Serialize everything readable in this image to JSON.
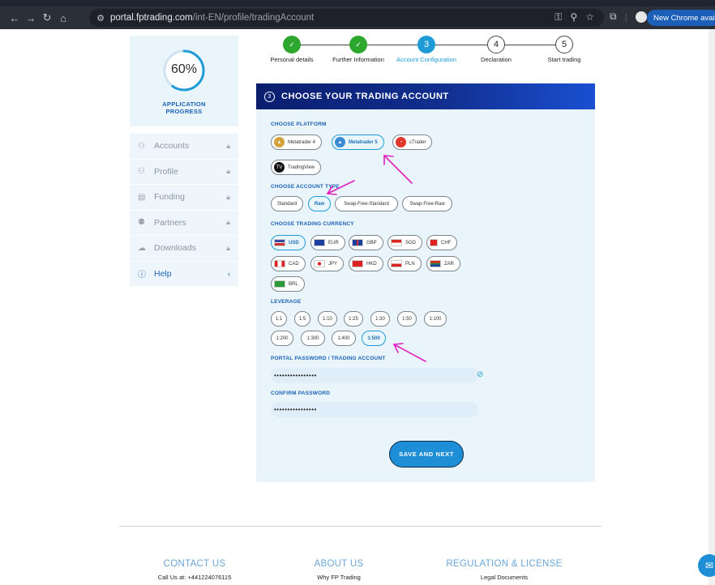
{
  "browser": {
    "url_host": "portal.fptrading.com",
    "url_path": "/int-EN/profile/tradingAccount",
    "update_label": "New Chrome available"
  },
  "sidebar": {
    "progress_value": "60%",
    "progress_fraction": 0.6,
    "progress_label_line1": "APPLICATION",
    "progress_label_line2": "PROGRESS",
    "items": [
      {
        "label": "Accounts",
        "icon": "user-icon",
        "locked": true
      },
      {
        "label": "Profile",
        "icon": "profile-icon",
        "locked": true
      },
      {
        "label": "Funding",
        "icon": "document-icon",
        "locked": true
      },
      {
        "label": "Partners",
        "icon": "partners-icon",
        "locked": true
      },
      {
        "label": "Downloads",
        "icon": "cloud-download-icon",
        "locked": true
      },
      {
        "label": "Help",
        "icon": "help-icon",
        "locked": false
      }
    ]
  },
  "stepper": {
    "steps": [
      {
        "label": "Personal details",
        "state": "done",
        "mark": "✓"
      },
      {
        "label": "Further Information",
        "state": "done",
        "mark": "✓"
      },
      {
        "label": "Account Configuration",
        "state": "active",
        "mark": "3"
      },
      {
        "label": "Declaration",
        "state": "todo",
        "mark": "4"
      },
      {
        "label": "Start trading",
        "state": "todo",
        "mark": "5"
      }
    ]
  },
  "form": {
    "step_number": "3",
    "title": "CHOOSE YOUR TRADING ACCOUNT",
    "platform_label": "CHOOSE PLATFORM",
    "platforms": [
      {
        "label": "Metatrader 4",
        "selected": false
      },
      {
        "label": "Metatrader 5",
        "selected": true
      },
      {
        "label": "cTrader",
        "selected": false
      },
      {
        "label": "TradingView",
        "selected": false
      }
    ],
    "account_type_label": "CHOOSE ACCOUNT TYPE",
    "account_types": [
      {
        "label": "Standard",
        "selected": false
      },
      {
        "label": "Raw",
        "selected": true
      },
      {
        "label": "Swap-Free-Standard",
        "selected": false
      },
      {
        "label": "Swap-Free-Raw",
        "selected": false
      }
    ],
    "currency_label": "CHOOSE TRADING CURRENCY",
    "currencies": [
      {
        "label": "USD",
        "selected": true
      },
      {
        "label": "EUR",
        "selected": false
      },
      {
        "label": "GBP",
        "selected": false
      },
      {
        "label": "SGD",
        "selected": false
      },
      {
        "label": "CHF",
        "selected": false
      },
      {
        "label": "CAD",
        "selected": false
      },
      {
        "label": "JPY",
        "selected": false
      },
      {
        "label": "HKD",
        "selected": false
      },
      {
        "label": "PLN",
        "selected": false
      },
      {
        "label": "ZAR",
        "selected": false
      },
      {
        "label": "BRL",
        "selected": false
      }
    ],
    "leverage_label": "LEVERAGE",
    "leverages": [
      {
        "label": "1:1",
        "selected": false
      },
      {
        "label": "1:5",
        "selected": false
      },
      {
        "label": "1:10",
        "selected": false
      },
      {
        "label": "1:25",
        "selected": false
      },
      {
        "label": "1:30",
        "selected": false
      },
      {
        "label": "1:50",
        "selected": false
      },
      {
        "label": "1:100",
        "selected": false
      },
      {
        "label": "1:200",
        "selected": false
      },
      {
        "label": "1:300",
        "selected": false
      },
      {
        "label": "1:400",
        "selected": false
      },
      {
        "label": "1:500",
        "selected": true
      }
    ],
    "password_label": "PORTAL PASSWORD / TRADING ACCOUNT",
    "password_value": "••••••••••••••••",
    "confirm_label": "CONFIRM PASSWORD",
    "confirm_value": "••••••••••••••••",
    "submit_label": "SAVE AND NEXT"
  },
  "footer": {
    "contact_head": "CONTACT US",
    "contact_sub": "Call Us at: +441224076115",
    "about_head": "ABOUT US",
    "about_sub": "Why FP Trading",
    "regulation_head": "REGULATION & LICENSE",
    "regulation_sub": "Legal Documents"
  },
  "colors": {
    "accent": "#1e9bd7",
    "done": "#2ea72e",
    "annotation": "#e020c0"
  }
}
